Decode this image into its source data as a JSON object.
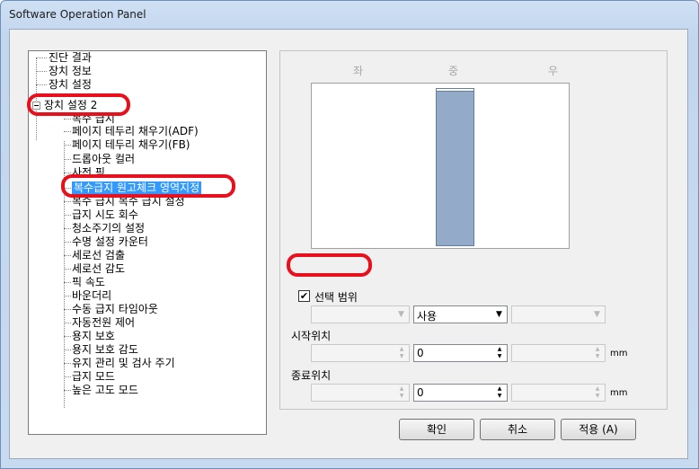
{
  "window": {
    "title": "Software Operation Panel"
  },
  "tree": {
    "items": [
      {
        "label": "진단 결과"
      },
      {
        "label": "장치 정보"
      },
      {
        "label": "장치 설정"
      },
      {
        "label": "장치 설정 2"
      },
      {
        "label": "복수 급지"
      },
      {
        "label": "페이지 테두리 채우기(ADF)"
      },
      {
        "label": "페이지 테두리 채우기(FB)"
      },
      {
        "label": "드롭아웃 컬러"
      },
      {
        "label": "사전 픽"
      },
      {
        "label": "복수급지 원고체크 영역지정"
      },
      {
        "label": "복수 급지 복수 급지 설정"
      },
      {
        "label": "급지 시도 회수"
      },
      {
        "label": "청소주기의 설정"
      },
      {
        "label": "수명 설정 카운터"
      },
      {
        "label": "세로선 검출"
      },
      {
        "label": "세로선 감도"
      },
      {
        "label": "픽 속도"
      },
      {
        "label": "바운더리"
      },
      {
        "label": "수동 급지 타임아웃"
      },
      {
        "label": "자동전원 제어"
      },
      {
        "label": "용지 보호"
      },
      {
        "label": "용지 보호 감도"
      },
      {
        "label": "유지 관리 및 검사 주기"
      },
      {
        "label": "급지 모드"
      },
      {
        "label": "높은 고도 모드"
      }
    ]
  },
  "panel": {
    "positions": {
      "left": "좌",
      "center": "중",
      "right": "우"
    },
    "checkbox": {
      "label": "선택 범위",
      "checked": true,
      "mark": "✔"
    },
    "combos": {
      "left": "",
      "center": "사용",
      "right": ""
    },
    "start": {
      "label": "시작위치",
      "left": "",
      "center": "0",
      "right": "",
      "unit": "mm"
    },
    "end": {
      "label": "종료위치",
      "left": "",
      "center": "0",
      "right": "",
      "unit": "mm"
    }
  },
  "buttons": {
    "ok": "확인",
    "cancel": "취소",
    "apply": "적용 (A)"
  },
  "icons": {
    "combo_arrow": "▼",
    "spin_up": "▲",
    "spin_down": "▼",
    "collapse": "minus-box"
  },
  "colors": {
    "callout": "#e8101c",
    "selection": "#3399ff",
    "bar": "#93abc8"
  }
}
